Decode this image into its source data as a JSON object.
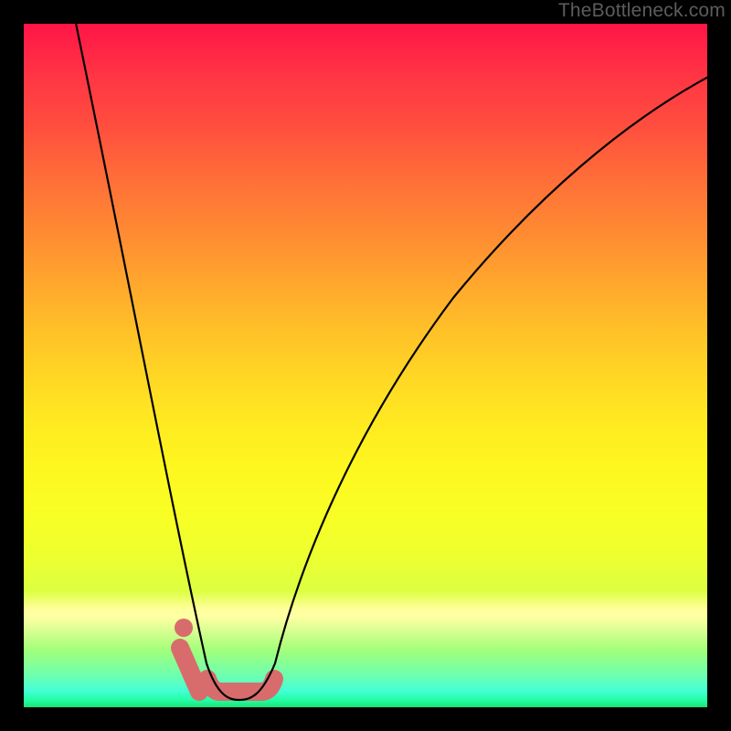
{
  "watermark": {
    "text": "TheBottleneck.com"
  },
  "colors": {
    "frame_bg": "#000000",
    "curve_stroke": "#000000",
    "highlight_stroke": "#D86C6C",
    "gradient_top": "#FF1547",
    "gradient_bottom": "#1AE273"
  },
  "chart_data": {
    "type": "line",
    "title": "",
    "xlabel": "",
    "ylabel": "",
    "ylim": [
      0,
      100
    ],
    "x": [
      0,
      5,
      10,
      15,
      20,
      22,
      24,
      26,
      28,
      30,
      32,
      34,
      36,
      38,
      40,
      45,
      50,
      55,
      60,
      70,
      80,
      90,
      100
    ],
    "values": [
      138,
      108,
      80,
      54,
      30,
      21,
      13,
      6,
      2,
      0,
      0,
      0,
      2,
      6,
      12,
      24,
      36,
      46,
      54,
      66,
      75,
      82,
      88
    ],
    "highlight_range_x": [
      22.5,
      37.5
    ],
    "highlight_marker_x": 23.5,
    "notes": "x is relative horizontal position (0-100) inside plot; values are approximate curve height as percent of plot height. Curve values above 100 are clipped by the top of the plot."
  }
}
